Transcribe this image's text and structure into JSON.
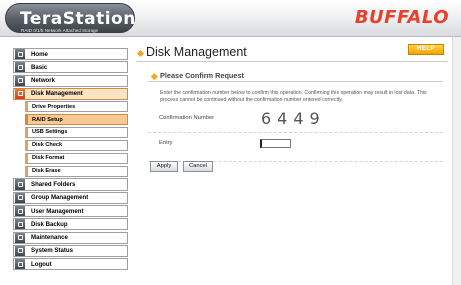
{
  "header": {
    "logo_title": "TeraStation",
    "logo_subtitle": "RAID 0/1/5 Network Attached Storage",
    "brand": "BUFFALO"
  },
  "sidebar": {
    "items": [
      {
        "label": "Home",
        "icon": "home-icon"
      },
      {
        "label": "Basic",
        "icon": "basic-settings-icon"
      },
      {
        "label": "Network",
        "icon": "network-icon"
      },
      {
        "label": "Disk Management",
        "icon": "disk-icon",
        "active": true
      },
      {
        "label": "Shared Folders",
        "icon": "folder-icon"
      },
      {
        "label": "Group Management",
        "icon": "group-icon"
      },
      {
        "label": "User Management",
        "icon": "user-icon"
      },
      {
        "label": "Disk Backup",
        "icon": "backup-icon"
      },
      {
        "label": "Maintenance",
        "icon": "maintenance-icon"
      },
      {
        "label": "System Status",
        "icon": "status-icon"
      },
      {
        "label": "Logout",
        "icon": "logout-icon"
      }
    ],
    "sub_items": [
      {
        "label": "Drive Properties"
      },
      {
        "label": "RAID Setup",
        "active": true
      },
      {
        "label": "USB Settings"
      },
      {
        "label": "Disk Check"
      },
      {
        "label": "Disk Format"
      },
      {
        "label": "Disk Erase"
      }
    ]
  },
  "main": {
    "page_title": "Disk Management",
    "help_label": "HELP",
    "section_title": "Please Confirm Request",
    "description": "Enter the confirmation number below to confirm this operation. Confirming this operation may result in lost data. This process cannot be continued without the confirmation number entered correctly.",
    "confirmation_label": "Confirmation Number",
    "confirmation_number": "6449",
    "entry_label": "Entry",
    "entry_value": "",
    "apply_label": "Apply",
    "cancel_label": "Cancel"
  },
  "colors": {
    "brand": "#e8402a",
    "accent": "#f3a81c",
    "active_nav": "#fbe3c3",
    "active_sub": "#f8c992"
  }
}
